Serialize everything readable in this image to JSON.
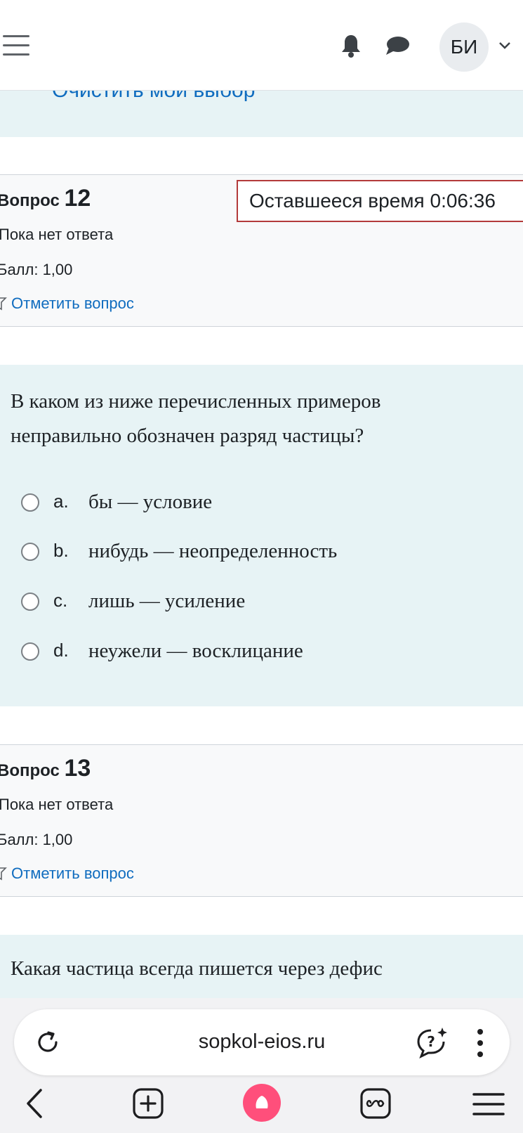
{
  "navbar": {
    "avatar_initials": "БИ",
    "icons": [
      "hamburger-menu-icon",
      "bell-icon",
      "chat-icon",
      "chevron-down-icon"
    ]
  },
  "previous_question": {
    "clear_choice_label": "Очистить мой выбор"
  },
  "timer": {
    "label": "Оставшееся время 0:06:36"
  },
  "questions": [
    {
      "prefix": "Вопрос",
      "number": "12",
      "state": "Пока нет ответа",
      "grade": "Балл: 1,00",
      "flag_label": "Отметить вопрос",
      "text": "В каком из ниже перечисленных примеров неправильно обозначен разряд частицы?",
      "answers": [
        {
          "letter": "a.",
          "text": "бы — условие"
        },
        {
          "letter": "b.",
          "text": "нибудь — неопределенность"
        },
        {
          "letter": "c.",
          "text": "лишь — усиление"
        },
        {
          "letter": "d.",
          "text": "неужели — восклицание"
        }
      ]
    },
    {
      "prefix": "Вопрос",
      "number": "13",
      "state": "Пока нет ответа",
      "grade": "Балл: 1,00",
      "flag_label": "Отметить вопрос",
      "text": "Какая частица всегда пишется через дефис"
    }
  ],
  "browser": {
    "url": "sopkol-eios.ru",
    "accent_color": "#ff4f7b",
    "icons": [
      "reload-icon",
      "assistant-icon",
      "more-vertical-icon",
      "back-icon",
      "new-tab-icon",
      "alice-icon",
      "tabs-icon",
      "menu-icon"
    ]
  }
}
